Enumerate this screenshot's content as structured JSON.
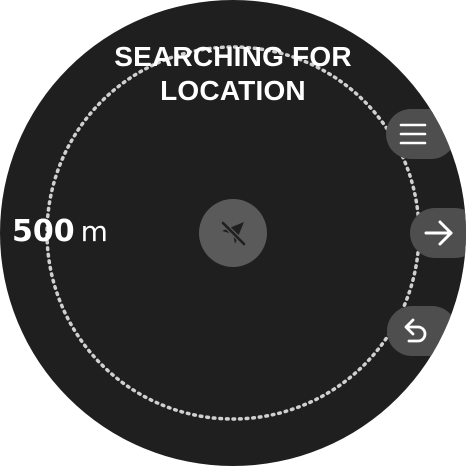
{
  "screen": {
    "status_title": "SEARCHING FOR LOCATION",
    "distance_value": "500",
    "distance_unit": "m"
  },
  "icons": {
    "center": "no-gps-navigation-arrow-icon",
    "menu": "menu-icon",
    "next": "arrow-right-icon",
    "back": "back-arrow-icon"
  },
  "colors": {
    "background": "#1f1f1f",
    "ring_dots": "#cfcfcf",
    "button": "#4e4e4e",
    "center_marker": "#5a5a5a",
    "text": "#ffffff"
  }
}
